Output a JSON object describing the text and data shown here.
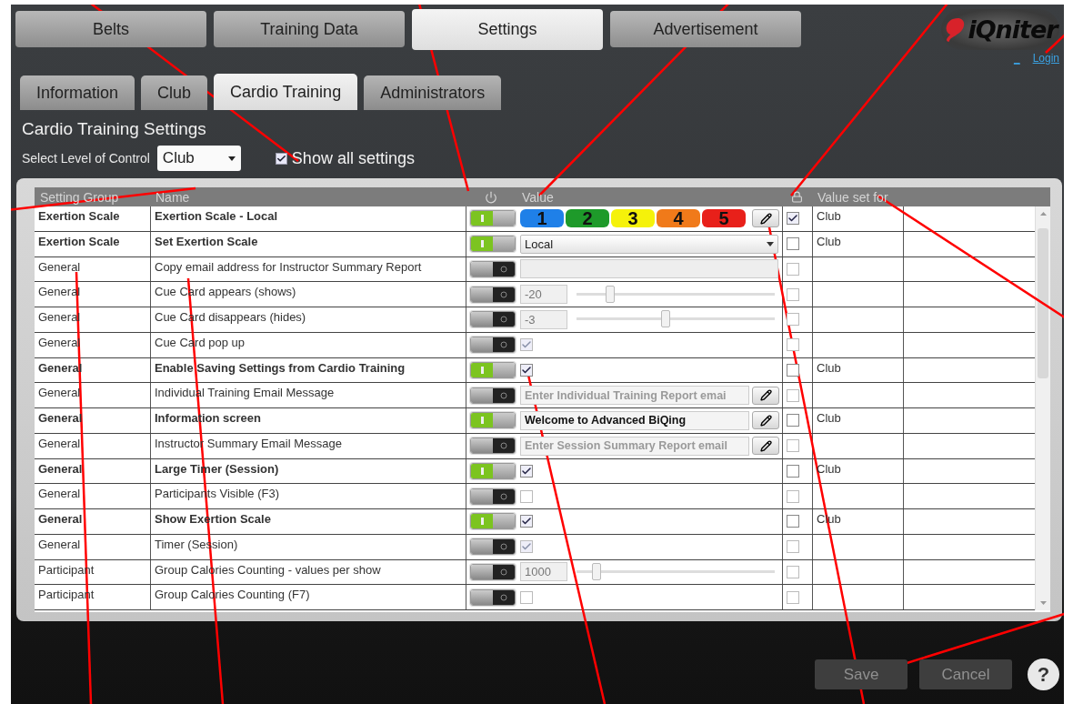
{
  "tabs": [
    {
      "label": "Belts",
      "selected": false
    },
    {
      "label": "Training Data",
      "selected": false
    },
    {
      "label": "Settings",
      "selected": true
    },
    {
      "label": "Advertisement",
      "selected": false
    }
  ],
  "logo": "iQniter",
  "login": {
    "prefix": "_",
    "link": "Login"
  },
  "subtabs": [
    {
      "label": "Information",
      "selected": false
    },
    {
      "label": "Club",
      "selected": false
    },
    {
      "label": "Cardio Training",
      "selected": true
    },
    {
      "label": "Administrators",
      "selected": false
    }
  ],
  "section_title": "Cardio Training Settings",
  "level_control": {
    "label": "Select Level of Control",
    "value": "Club"
  },
  "show_all": {
    "label": "Show all settings",
    "checked": true
  },
  "table": {
    "columns": [
      {
        "kind": "text",
        "label": "Setting Group"
      },
      {
        "kind": "text",
        "label": "Name"
      },
      {
        "kind": "power"
      },
      {
        "kind": "text",
        "label": "Value"
      },
      {
        "kind": "lock"
      },
      {
        "kind": "text",
        "label": "Value set for"
      }
    ],
    "rows": [
      {
        "group": "Exertion Scale",
        "name": "Exertion Scale - Local",
        "on": true,
        "value": {
          "kind": "scale",
          "chips": [
            {
              "label": "1",
              "color": "#1f80e8"
            },
            {
              "label": "2",
              "color": "#1e9a2a"
            },
            {
              "label": "3",
              "color": "#f5f20a"
            },
            {
              "label": "4",
              "color": "#f07a1a"
            },
            {
              "label": "5",
              "color": "#e8201a"
            }
          ]
        },
        "locked": true,
        "set_for": "Club"
      },
      {
        "group": "Exertion Scale",
        "name": "Set Exertion Scale",
        "on": true,
        "value": {
          "kind": "select",
          "value": "Local"
        },
        "locked": false,
        "set_for": "Club"
      },
      {
        "group": "General",
        "name": "Copy email address for Instructor Summary Report",
        "on": false,
        "value": {
          "kind": "field"
        },
        "locked": false
      },
      {
        "group": "General",
        "name": "Cue Card appears (shows)",
        "on": false,
        "value": {
          "kind": "slider",
          "reading": "-20",
          "level": 0.17
        },
        "locked": false
      },
      {
        "group": "General",
        "name": "Cue Card disappears (hides)",
        "on": false,
        "value": {
          "kind": "slider",
          "reading": "-3",
          "level": 0.45
        },
        "locked": false
      },
      {
        "group": "General",
        "name": "Cue Card pop up",
        "on": false,
        "value": {
          "kind": "checkbox",
          "checked": true
        },
        "locked": false
      },
      {
        "group": "General",
        "name": "Enable Saving Settings from Cardio Training",
        "on": true,
        "value": {
          "kind": "checkbox",
          "checked": true
        },
        "locked": false,
        "set_for": "Club"
      },
      {
        "group": "General",
        "name": "Individual Training Email Message",
        "on": false,
        "value": {
          "kind": "note",
          "placeholder": "Enter Individual Training Report emai"
        },
        "locked": false
      },
      {
        "group": "General",
        "name": "Information screen",
        "on": true,
        "value": {
          "kind": "note",
          "value": "Welcome to Advanced BiQing"
        },
        "locked": false,
        "set_for": "Club"
      },
      {
        "group": "General",
        "name": "Instructor Summary Email Message",
        "on": false,
        "value": {
          "kind": "note",
          "placeholder": "Enter Session Summary Report email"
        },
        "locked": false
      },
      {
        "group": "General",
        "name": "Large Timer (Session)",
        "on": true,
        "value": {
          "kind": "checkbox",
          "checked": true
        },
        "locked": false,
        "set_for": "Club"
      },
      {
        "group": "General",
        "name": "Participants Visible (F3)",
        "on": false,
        "value": {
          "kind": "checkbox",
          "checked": false
        },
        "locked": false
      },
      {
        "group": "General",
        "name": "Show Exertion Scale",
        "on": true,
        "value": {
          "kind": "checkbox",
          "checked": true
        },
        "locked": false,
        "set_for": "Club"
      },
      {
        "group": "General",
        "name": "Timer (Session)",
        "on": false,
        "value": {
          "kind": "checkbox",
          "checked": true
        },
        "locked": false
      },
      {
        "group": "Participant",
        "name": "Group Calories Counting - values per show",
        "on": false,
        "value": {
          "kind": "slider",
          "reading": "1000",
          "level": 0.1
        },
        "locked": false
      },
      {
        "group": "Participant",
        "name": "Group Calories Counting (F7)",
        "on": false,
        "value": {
          "kind": "checkbox",
          "checked": false
        },
        "locked": false
      }
    ]
  },
  "buttons": [
    {
      "label": "Save",
      "disabled": true
    },
    {
      "label": "Cancel",
      "disabled": true
    }
  ],
  "help": "?"
}
